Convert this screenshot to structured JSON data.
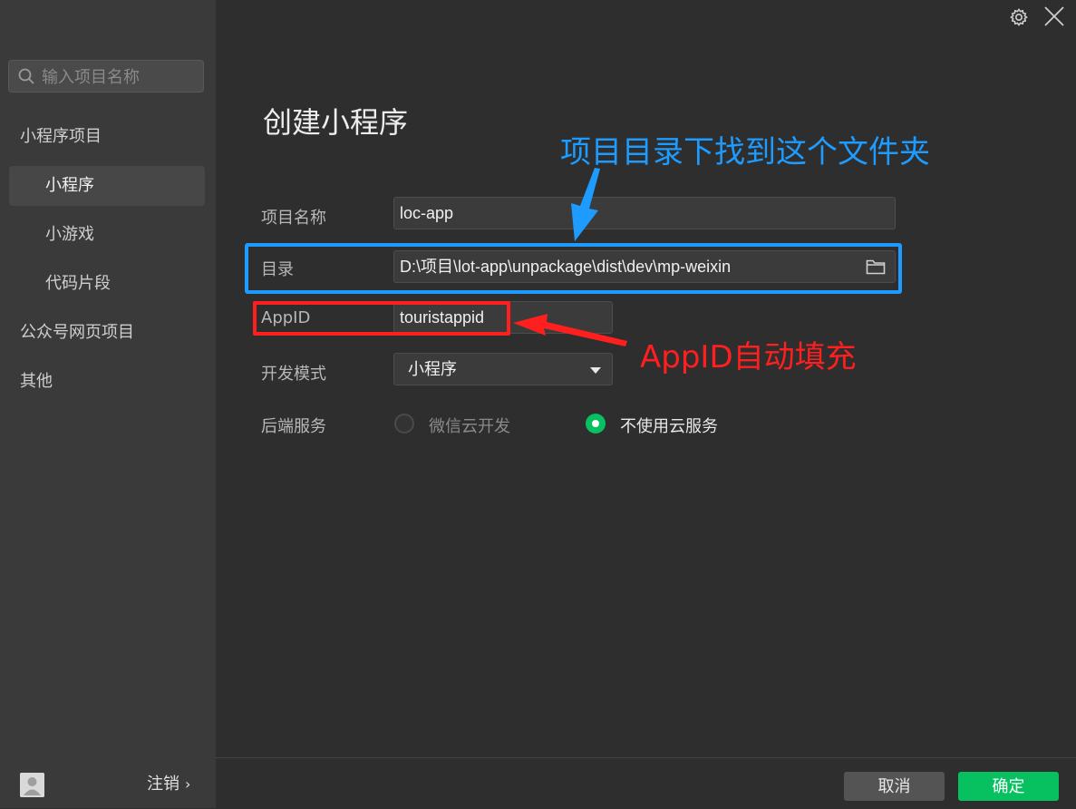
{
  "sidebar": {
    "search_placeholder": "输入项目名称",
    "items": [
      {
        "label": "小程序项目",
        "level": "top"
      },
      {
        "label": "小程序",
        "level": "sub",
        "active": true
      },
      {
        "label": "小游戏",
        "level": "sub"
      },
      {
        "label": "代码片段",
        "level": "sub"
      },
      {
        "label": "公众号网页项目",
        "level": "top"
      },
      {
        "label": "其他",
        "level": "top"
      }
    ],
    "logout_label": "注销",
    "logout_chevron": "›"
  },
  "window_icons": [
    "gear-icon",
    "close-icon"
  ],
  "form": {
    "title": "创建小程序",
    "project_name_label": "项目名称",
    "project_name_value": "loc-app",
    "directory_label": "目录",
    "directory_value": "D:\\项目\\lot-app\\unpackage\\dist\\dev\\mp-weixin",
    "appid_label": "AppID",
    "appid_value": "touristappid",
    "dev_mode_label": "开发模式",
    "dev_mode_value": "小程序",
    "backend_label": "后端服务",
    "backend_options": [
      {
        "label": "微信云开发",
        "selected": false
      },
      {
        "label": "不使用云服务",
        "selected": true
      }
    ]
  },
  "footer": {
    "cancel_label": "取消",
    "ok_label": "确定"
  },
  "annotations": {
    "blue_text": "项目目录下找到这个文件夹",
    "red_text": "AppID自动填充",
    "blue_color": "#1e9bff",
    "red_color": "#ff1f1f"
  },
  "colors": {
    "accent_green": "#07c160",
    "sidebar_bg": "#3a3a3a",
    "main_bg": "#2e2e2e"
  }
}
